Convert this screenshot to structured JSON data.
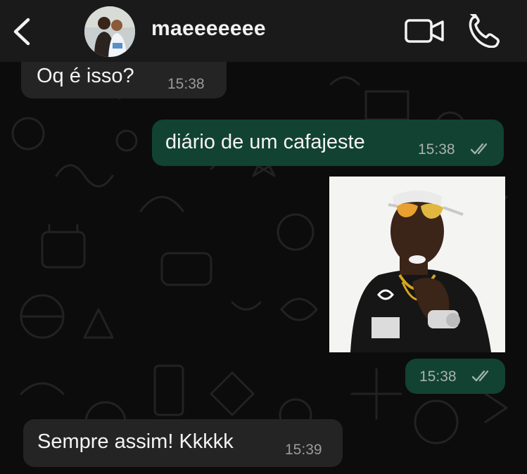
{
  "header": {
    "contact_name": "maeeeeeee",
    "icons": {
      "back": "chevron-left-icon",
      "video": "video-camera-icon",
      "call": "phone-icon"
    }
  },
  "messages": [
    {
      "direction": "incoming",
      "text": "Oq é isso?",
      "time": "15:38"
    },
    {
      "direction": "outgoing",
      "text": "diário de um cafajeste",
      "time": "15:38",
      "status": "read"
    },
    {
      "direction": "outgoing",
      "type": "image",
      "text": "",
      "time": "15:38",
      "status": "read"
    },
    {
      "direction": "incoming",
      "text": "Sempre assim! Kkkkk",
      "time": "15:39"
    }
  ],
  "colors": {
    "header_bg": "#1a1a1a",
    "background": "#0c0c0c",
    "incoming_bubble": "#242424",
    "outgoing_bubble": "#124232",
    "text": "#f4f4f4",
    "timestamp": "#a9b2ae"
  }
}
